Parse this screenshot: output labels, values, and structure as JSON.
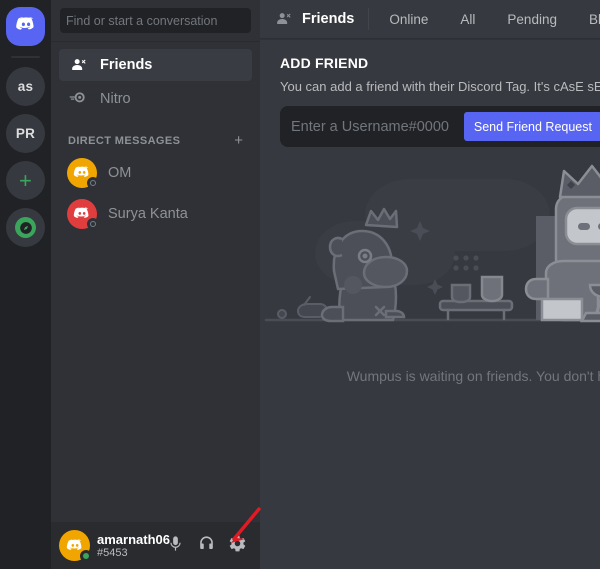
{
  "app": {
    "name": "Discord"
  },
  "server_rail": {
    "home": {
      "label": "Discord",
      "icon": "discord-home-icon"
    },
    "servers": [
      {
        "label": "as",
        "name": "server-as"
      },
      {
        "label": "PR",
        "name": "server-pr"
      }
    ],
    "add_server": {
      "label": "+",
      "name": "add-server"
    },
    "explore": {
      "label": "",
      "name": "explore-servers"
    }
  },
  "sidebar": {
    "search": {
      "placeholder": "Find or start a conversation",
      "value": ""
    },
    "nav": [
      {
        "label": "Friends",
        "icon": "friends-icon",
        "active": true
      },
      {
        "label": "Nitro",
        "icon": "nitro-icon",
        "active": false
      }
    ],
    "dm_section": {
      "label": "DIRECT MESSAGES",
      "add_label": "+"
    },
    "dms": [
      {
        "name": "OM",
        "avatar_color": "#f0a500",
        "status": "offline"
      },
      {
        "name": "Surya Kanta",
        "avatar_color": "#e03e3e",
        "status": "offline"
      }
    ]
  },
  "user_panel": {
    "username": "amarnath06",
    "discriminator": "#5453",
    "avatar_color": "#f0a500",
    "status": "online",
    "actions": [
      {
        "label": "Mute",
        "icon": "microphone-icon"
      },
      {
        "label": "Deafen",
        "icon": "headphones-icon"
      },
      {
        "label": "User Settings",
        "icon": "gear-icon"
      }
    ]
  },
  "topbar": {
    "title": "Friends",
    "icon": "friends-icon",
    "tabs": [
      {
        "label": "Online",
        "active": false
      },
      {
        "label": "All",
        "active": false
      },
      {
        "label": "Pending",
        "active": false
      },
      {
        "label": "Blocked",
        "active": false
      }
    ]
  },
  "add_friend": {
    "title": "ADD FRIEND",
    "subtitle": "You can add a friend with their Discord Tag. It's cAsE sEnSitIvE!",
    "input_placeholder": "Enter a Username#0000",
    "input_value": "",
    "submit_label": "Send Friend Request"
  },
  "empty_state": {
    "illustration": "wumpus-waiting-illustration",
    "text": "Wumpus is waiting on friends. You don't have to"
  },
  "annotation": {
    "arrow": {
      "color": "#e01b24",
      "points_to": "gear-icon"
    }
  },
  "colors": {
    "brand_blurple": "#5865f2",
    "rail_bg": "#202225",
    "sidebar_bg": "#2f3136",
    "main_bg": "#36393f",
    "online_green": "#3ba55c",
    "annotation_red": "#e01b24"
  }
}
